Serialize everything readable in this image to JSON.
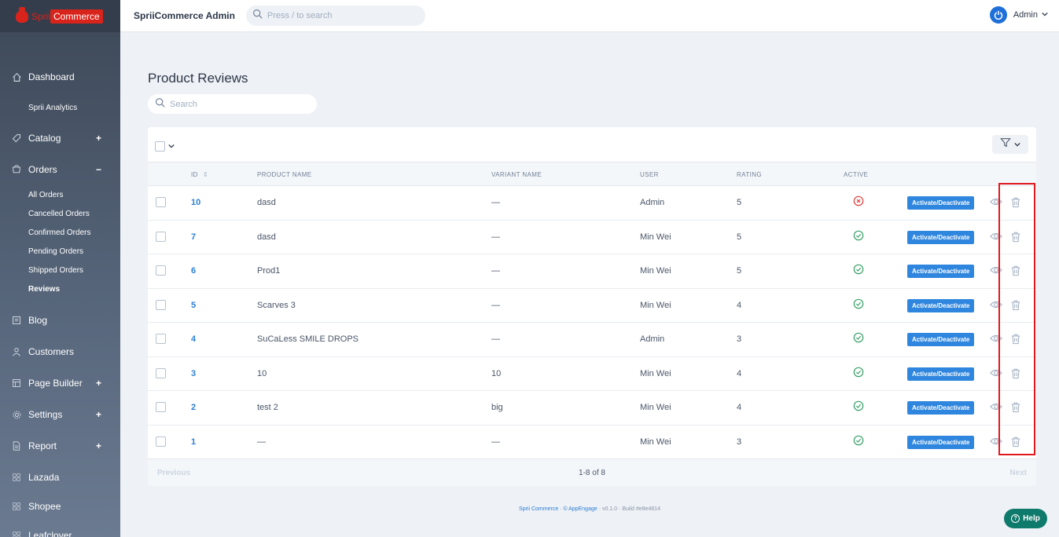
{
  "brand": {
    "name_part1": "Sprii",
    "name_part2": "Commerce"
  },
  "topbar": {
    "app_title": "SpriiCommerce Admin",
    "search_placeholder": "Press / to search",
    "user_name": "Admin"
  },
  "sidebar": {
    "dashboard": "Dashboard",
    "analytics": "Sprii Analytics",
    "catalog": "Catalog",
    "orders": "Orders",
    "orders_sub": [
      "All Orders",
      "Cancelled Orders",
      "Confirmed Orders",
      "Pending Orders",
      "Shipped Orders",
      "Reviews"
    ],
    "blog": "Blog",
    "customers": "Customers",
    "page_builder": "Page Builder",
    "settings": "Settings",
    "report": "Report",
    "lazada": "Lazada",
    "shopee": "Shopee",
    "leafclover": "Leafclover",
    "plus": "+",
    "minus": "−"
  },
  "page": {
    "title": "Product Reviews",
    "search_placeholder": "Search"
  },
  "table": {
    "headers": {
      "id": "ID",
      "product": "PRODUCT NAME",
      "variant": "VARIANT NAME",
      "user": "USER",
      "rating": "RATING",
      "active": "ACTIVE"
    },
    "action_label": "Activate/Deactivate",
    "rows": [
      {
        "id": "10",
        "product": "dasd",
        "variant": "—",
        "user": "Admin",
        "rating": "5",
        "active": false
      },
      {
        "id": "7",
        "product": "dasd",
        "variant": "—",
        "user": "Min Wei",
        "rating": "5",
        "active": true
      },
      {
        "id": "6",
        "product": "Prod1",
        "variant": "—",
        "user": "Min Wei",
        "rating": "5",
        "active": true
      },
      {
        "id": "5",
        "product": "Scarves 3",
        "variant": "—",
        "user": "Min Wei",
        "rating": "4",
        "active": true
      },
      {
        "id": "4",
        "product": "SuCaLess SMILE DROPS",
        "variant": "—",
        "user": "Admin",
        "rating": "3",
        "active": true
      },
      {
        "id": "3",
        "product": "10",
        "variant": "10",
        "user": "Min Wei",
        "rating": "4",
        "active": true
      },
      {
        "id": "2",
        "product": "test 2",
        "variant": "big",
        "user": "Min Wei",
        "rating": "4",
        "active": true
      },
      {
        "id": "1",
        "product": "—",
        "variant": "—",
        "user": "Min Wei",
        "rating": "3",
        "active": true
      }
    ],
    "pagination": {
      "previous": "Previous",
      "info": "1-8 of 8",
      "next": "Next"
    }
  },
  "footer": {
    "brand": "Sprii Commerce",
    "sep1": " · ",
    "copyright": "© AppEngage",
    "sep2": " · ",
    "version": "v0.1.0",
    "sep3": " · ",
    "build": "Build #e8e4814"
  },
  "help": {
    "label": "Help"
  },
  "colors": {
    "primary": "#2f86de",
    "active_ok": "#38a169",
    "inactive": "#e53e3e",
    "highlight": "#e0181e",
    "help": "#0e7a6c"
  }
}
